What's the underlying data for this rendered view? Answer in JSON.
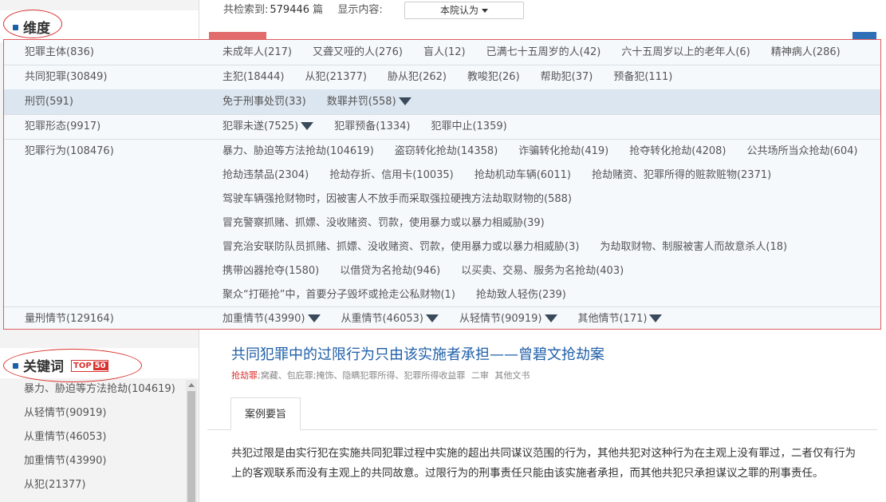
{
  "sidebar": {
    "dimension_title": "维度",
    "keyword_title": "关键词",
    "top_badge": {
      "prefix": "TOP",
      "number": "50"
    },
    "keywords": [
      "暴力、胁迫等方法抢劫(104619)",
      "从轻情节(90919)",
      "从重情节(46053)",
      "加重情节(43990)",
      "从犯(21377)"
    ]
  },
  "topbar": {
    "total_label": "共检索到:",
    "total_count": "579446",
    "total_unit": "篇",
    "display_label": "显示内容:",
    "display_value": "本院认为"
  },
  "facets": [
    {
      "label": "犯罪主体(836)",
      "lines": [
        [
          {
            "text": "未成年人(217)"
          },
          {
            "text": "又聋又哑的人(276)"
          },
          {
            "text": "盲人(12)"
          },
          {
            "text": "已满七十五周岁的人(42)"
          },
          {
            "text": "六十五周岁以上的老年人(6)"
          },
          {
            "text": "精神病人(286)"
          }
        ]
      ]
    },
    {
      "label": "共同犯罪(30849)",
      "lines": [
        [
          {
            "text": "主犯(18444)"
          },
          {
            "text": "从犯(21377)"
          },
          {
            "text": "胁从犯(262)"
          },
          {
            "text": "教唆犯(26)"
          },
          {
            "text": "帮助犯(37)"
          },
          {
            "text": "预备犯(111)"
          }
        ]
      ]
    },
    {
      "label": "刑罚(591)",
      "lines": [
        [
          {
            "text": "免于刑事处罚(33)"
          },
          {
            "text": "数罪并罚(558)",
            "expand": true
          }
        ]
      ]
    },
    {
      "label": "犯罪形态(9917)",
      "lines": [
        [
          {
            "text": "犯罪未遂(7525)",
            "expand": true
          },
          {
            "text": "犯罪预备(1334)"
          },
          {
            "text": "犯罪中止(1359)"
          }
        ]
      ]
    },
    {
      "label": "犯罪行为(108476)",
      "lines": [
        [
          {
            "text": "暴力、胁迫等方法抢劫(104619)"
          },
          {
            "text": "盗窃转化抢劫(14358)"
          },
          {
            "text": "诈骗转化抢劫(419)"
          },
          {
            "text": "抢夺转化抢劫(4208)"
          },
          {
            "text": "公共场所当众抢劫(604)"
          }
        ],
        [
          {
            "text": "抢劫违禁品(2304)"
          },
          {
            "text": "抢劫存折、信用卡(10035)"
          },
          {
            "text": "抢劫机动车辆(6011)"
          },
          {
            "text": "抢劫赌资、犯罪所得的赃款赃物(2371)"
          }
        ],
        [
          {
            "text": "驾驶车辆强抢财物时，因被害人不放手而采取强拉硬拽方法劫取财物的(588)"
          }
        ],
        [
          {
            "text": "冒充警察抓赌、抓嫖、没收赌资、罚款，使用暴力或以暴力相威胁(39)"
          }
        ],
        [
          {
            "text": "冒充治安联防队员抓赌、抓嫖、没收赌资、罚款，使用暴力或以暴力相威胁(3)"
          },
          {
            "text": "为劫取财物、制服被害人而故意杀人(18)"
          }
        ],
        [
          {
            "text": "携带凶器抢夺(1580)"
          },
          {
            "text": "以借贷为名抢劫(946)"
          },
          {
            "text": "以买卖、交易、服务为名抢劫(403)"
          }
        ],
        [
          {
            "text": "聚众“打砸抢”中，首要分子毁坏或抢走公私财物(1)"
          },
          {
            "text": "抢劫致人轻伤(239)"
          }
        ]
      ]
    },
    {
      "label": "量刑情节(129164)",
      "lines": [
        [
          {
            "text": "加重情节(43990)",
            "expand": true
          },
          {
            "text": "从重情节(46053)",
            "expand": true
          },
          {
            "text": "从轻情节(90919)",
            "expand": true
          },
          {
            "text": "其他情节(171)",
            "expand": true
          }
        ]
      ]
    }
  ],
  "result": {
    "title": "共同犯罪中的过限行为只由该实施者承担——曾碧文抢劫案",
    "meta_red": "抢劫罪",
    "meta_rest": ";窝藏、包庇罪;掩饰、隐瞒犯罪所得、犯罪所得收益罪",
    "meta_level": "二审",
    "meta_type": "其他文书",
    "tab_label": "案例要旨",
    "summary": "共犯过限是由实行犯在实施共同犯罪过程中实施的超出共同谋议范围的行为，其他共犯对这种行为在主观上没有罪过，二者仅有行为上的客观联系而没有主观上的共同故意。过限行为的刑事责任只能由该实施者承担，而其他共犯只承担谋议之罪的刑事责任。"
  },
  "colors": {
    "accent_blue": "#1f5fa8",
    "annotation_red": "#d9322e",
    "highlight_row": "#dce6f0"
  }
}
